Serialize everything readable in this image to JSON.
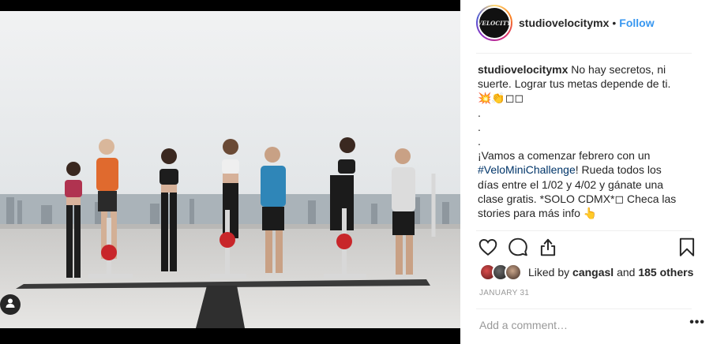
{
  "photo": {
    "alt_icon": "user-tag-icon"
  },
  "header": {
    "avatar_text": "VELOCITY",
    "username": "studiovelocitymx",
    "separator": "•",
    "follow_label": "Follow"
  },
  "caption": {
    "username": "studiovelocitymx",
    "text_part1": " No hay secretos, ni suerte. Lograr tus metas depende de ti.\n💥👏◻◻\n.\n.\n.\n¡Vamos a comenzar febrero con un ",
    "hashtag": "#VeloMiniChallenge",
    "text_part2": "! Rueda todos los días entre el 1/02 y 4/02 y gánate una clase gratis. *SOLO CDMX*◻ Checa las stories para más info 👆"
  },
  "actions": {
    "like_icon": "heart-icon",
    "comment_icon": "comment-icon",
    "share_icon": "share-icon",
    "save_icon": "bookmark-icon"
  },
  "likes": {
    "prefix": "Liked by ",
    "user": "cangasl",
    "middle": " and ",
    "others": "185 others"
  },
  "date": "JANUARY 31",
  "comment": {
    "placeholder": "Add a comment…",
    "more": "•••"
  },
  "colors": {
    "link_blue": "#3897f0",
    "hashtag": "#003569",
    "muted": "#999999",
    "divider": "#efefef"
  }
}
